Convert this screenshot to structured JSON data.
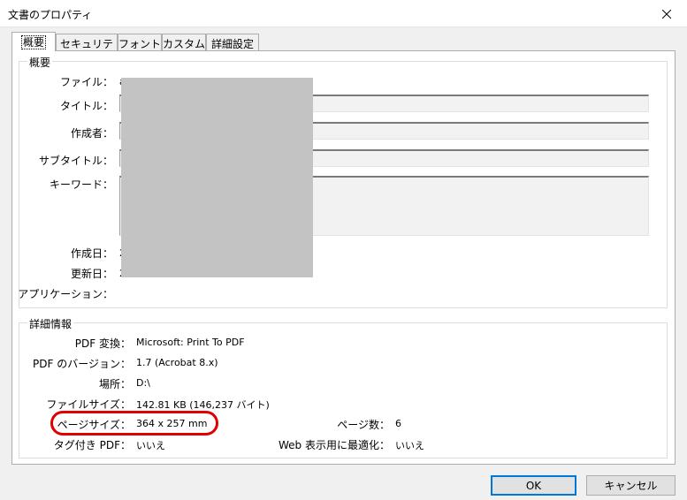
{
  "window": {
    "title": "文書のプロパティ"
  },
  "tabs": [
    {
      "label": "概要"
    },
    {
      "label": "セキュリティ"
    },
    {
      "label": "フォント"
    },
    {
      "label": "カスタム"
    },
    {
      "label": "詳細設定"
    }
  ],
  "summary": {
    "legend": "概要",
    "file_label": "ファイル：",
    "file_value_partial": "a",
    "title_label": "タイトル：",
    "author_label": "作成者：",
    "subject_label": "サブタイトル：",
    "keywords_label": "キーワード：",
    "created_label": "作成日：",
    "created_value_partial": "2",
    "modified_label": "更新日：",
    "modified_value_partial": "2",
    "application_label": "アプリケーション："
  },
  "details": {
    "legend": "詳細情報",
    "producer_label": "PDF 変換：",
    "producer_value": "Microsoft: Print To PDF",
    "version_label": "PDF のバージョン：",
    "version_value": "1.7 (Acrobat 8.x)",
    "location_label": "場所：",
    "location_value": "D:\\",
    "filesize_label": "ファイルサイズ：",
    "filesize_value": "142.81 KB (146,237 バイト)",
    "pagesize_label": "ページサイズ：",
    "pagesize_value": "364 x 257 mm",
    "pagecount_label": "ページ数：",
    "pagecount_value": "6",
    "tagged_label": "タグ付き PDF：",
    "tagged_value": "いいえ",
    "fastweb_label": "Web 表示用に最適化：",
    "fastweb_value": "いいえ"
  },
  "buttons": {
    "ok": "OK",
    "cancel": "キャンセル"
  },
  "colors": {
    "highlight": "#e00000",
    "redaction": "#c3c3c3",
    "default_button_border": "#0078d7"
  }
}
